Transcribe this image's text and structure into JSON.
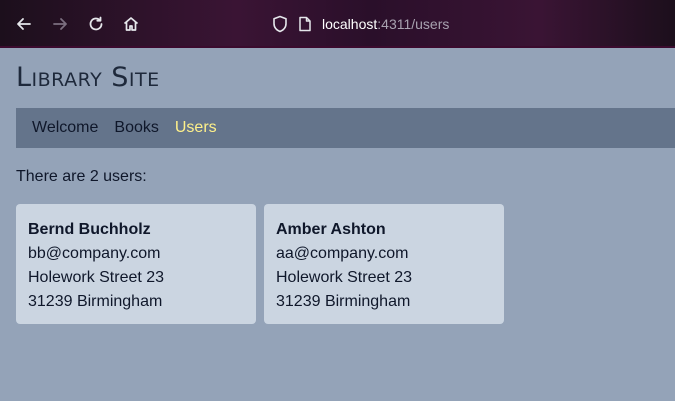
{
  "browser": {
    "url_host": "localhost",
    "url_rest": ":4311/users"
  },
  "site": {
    "title": "Library Site"
  },
  "nav": {
    "items": [
      {
        "label": "Welcome",
        "active": false
      },
      {
        "label": "Books",
        "active": false
      },
      {
        "label": "Users",
        "active": true
      }
    ]
  },
  "users": {
    "count_text": "There are 2 users:",
    "list": [
      {
        "name": "Bernd Buchholz",
        "email": "bb@company.com",
        "street": "Holework Street 23",
        "city": "31239 Birmingham"
      },
      {
        "name": "Amber Ashton",
        "email": "aa@company.com",
        "street": "Holework Street 23",
        "city": "31239 Birmingham"
      }
    ]
  },
  "colors": {
    "page_bg": "#94a3b8",
    "nav_bg": "#64748b",
    "card_bg": "#cbd5e1",
    "active_link": "#fef08a"
  }
}
